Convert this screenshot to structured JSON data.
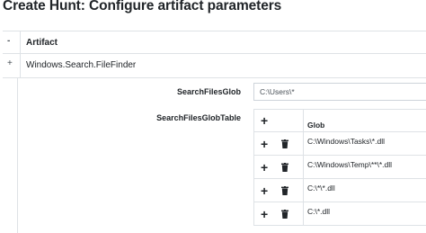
{
  "page": {
    "title": "Create Hunt: Configure artifact parameters"
  },
  "artifacts_table": {
    "header": {
      "toggle": "-",
      "label": "Artifact"
    },
    "row": {
      "toggle": "+",
      "name": "Windows.Search.FileFinder"
    }
  },
  "params": {
    "glob": {
      "label": "SearchFilesGlob",
      "value": "C:\\Users\\*"
    },
    "glob_table": {
      "label": "SearchFilesGlobTable",
      "add_symbol": "+",
      "column": "Glob",
      "rows": [
        "C:\\Windows\\Tasks\\*.dll",
        "C:\\Windows\\Temp\\**\\*.dll",
        "C:\\*\\*.dll",
        "C:\\*.dll"
      ]
    }
  },
  "icons": {
    "add": "plus-icon",
    "delete": "trash-icon"
  }
}
